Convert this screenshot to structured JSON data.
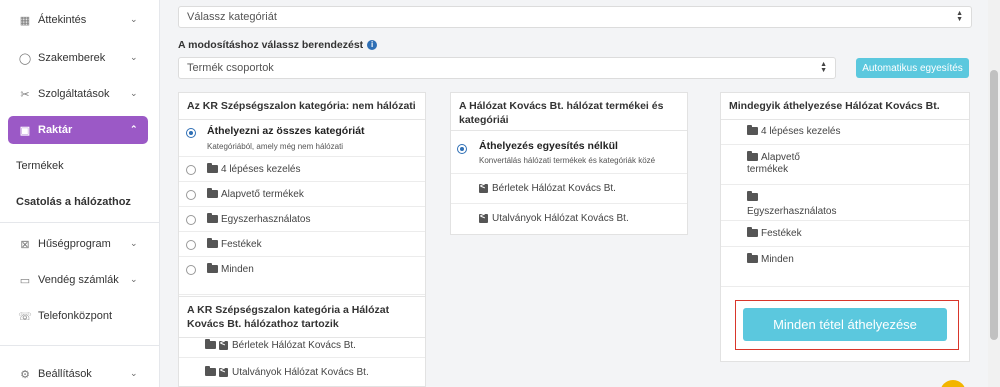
{
  "sidebar": {
    "items": [
      {
        "label": "Áttekintés",
        "icon": "grid-icon"
      },
      {
        "label": "Szakemberek",
        "icon": "user-icon"
      },
      {
        "label": "Szolgáltatások",
        "icon": "scissors-icon"
      },
      {
        "label": "Raktár",
        "icon": "box-icon"
      },
      {
        "label": "Hűségprogram",
        "icon": "gift-icon"
      },
      {
        "label": "Vendég számlák",
        "icon": "wallet-icon"
      },
      {
        "label": "Telefonközpont",
        "icon": "phone-icon"
      },
      {
        "label": "Beállítások",
        "icon": "gear-icon"
      }
    ],
    "sub": {
      "products": "Termékek",
      "network": "Csatolás a hálózathoz"
    }
  },
  "main": {
    "category_select": "Válassz kategóriát",
    "device_label": "A modosításhoz válassz berendezést",
    "device_select": "Termék csoportok",
    "auto_button": "Automatikus egyesítés",
    "panel_left": {
      "title": "Az KR Szépségszalon kategória: nem hálózati",
      "option_all_title": "Áthelyezni az összes kategóriát",
      "option_all_desc": "Kategóriából, amely még nem hálózati",
      "categories": [
        "4 lépéses kezelés",
        "Alapvető termékek",
        "Egyszerhasználatos",
        "Festékek",
        "Minden"
      ],
      "section2_title": "A KR Szépségszalon kategória a Hálózat Kovács Bt. hálózathoz tartozik",
      "linked": [
        "Bérletek Hálózat Kovács Bt.",
        "Utalványok Hálózat Kovács Bt."
      ]
    },
    "panel_mid": {
      "title": "A Hálózat Kovács Bt. hálózat termékei és kategóriái",
      "option_title": "Áthelyezés egyesítés nélkül",
      "option_desc": "Konvertálás hálózati termékek és kategóriák közé",
      "items": [
        "Bérletek Hálózat Kovács Bt.",
        "Utalványok Hálózat Kovács Bt."
      ]
    },
    "panel_right": {
      "title": "Mindegyik áthelyezése Hálózat Kovács Bt.",
      "items": [
        "4 lépéses kezelés",
        "Alapvető termékek",
        "Egyszerhasználatos",
        "Festékek",
        "Minden"
      ],
      "move_all_button": "Minden tétel áthelyezése"
    }
  },
  "colors": {
    "accent": "#9b59c6",
    "button": "#5bc8de",
    "highlight": "#d9362b",
    "radio": "#2f6fb5"
  }
}
